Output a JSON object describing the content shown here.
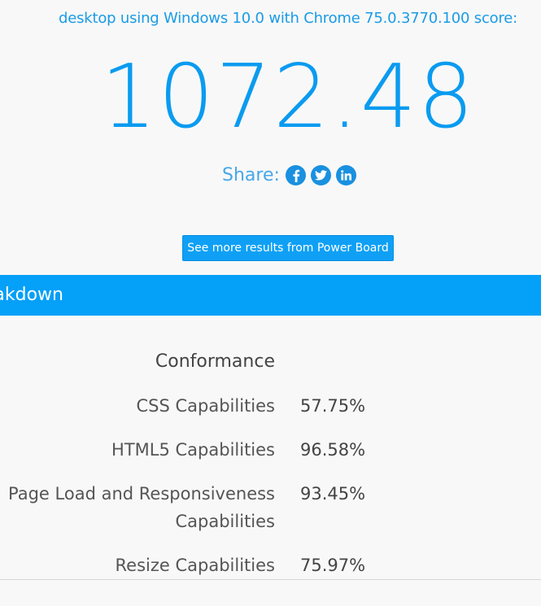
{
  "header": {
    "subtitle": "desktop using Windows 10.0 with Chrome 75.0.3770.100 score:",
    "score": "1072.48"
  },
  "share": {
    "label": "Share:",
    "icons": [
      "facebook-icon",
      "twitter-icon",
      "linkedin-icon"
    ]
  },
  "more_button": {
    "label": "See more results from Power Board"
  },
  "banner": {
    "title": "eakdown"
  },
  "breakdown": {
    "heading": "Conformance",
    "rows": [
      {
        "label": "CSS Capabilities",
        "value": "57.75%"
      },
      {
        "label": "HTML5 Capabilities",
        "value": "96.58%"
      },
      {
        "label_line1": "Page Load and Responsiveness",
        "label_line2": "Capabilities",
        "value": "93.45%"
      },
      {
        "label": "Resize Capabilities",
        "value": "75.97%"
      }
    ]
  },
  "colors": {
    "accent": "#05a0f8",
    "score_text": "#0a9bf0",
    "background": "#f8f8f8"
  }
}
